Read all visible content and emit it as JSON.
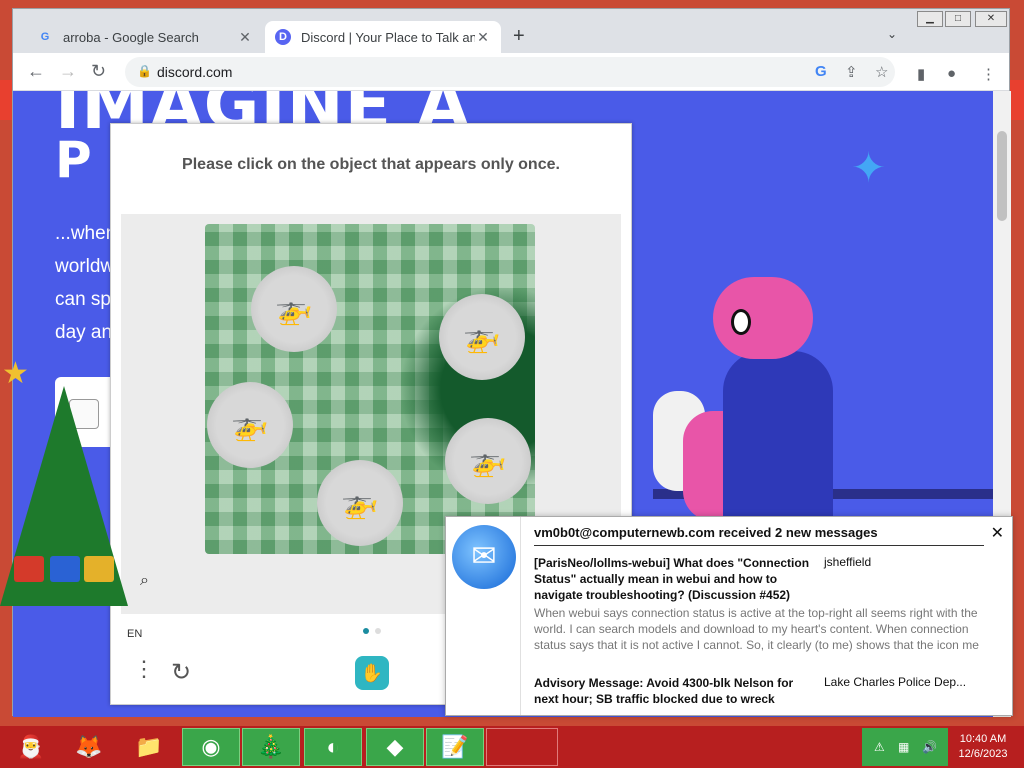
{
  "browser": {
    "tabs": [
      {
        "title": "arroba - Google Search",
        "favicon": "G"
      },
      {
        "title": "Discord | Your Place to Talk and H",
        "favicon": "D"
      }
    ],
    "url": "discord.com",
    "nav_icons": {
      "back": "←",
      "forward": "→",
      "reload": "↻"
    }
  },
  "page": {
    "hero_line1": "IMAGINE A",
    "hero_line2": "P",
    "desc_lines": [
      "...when",
      "worldw",
      "can sp",
      "day an"
    ]
  },
  "captcha": {
    "prompt": "Please click on the object that appears only once.",
    "language": "EN",
    "logo": "✋"
  },
  "notification": {
    "header": "vm0b0t@computernewb.com received 2 new messages",
    "messages": [
      {
        "subject": "[ParisNeo/lollms-webui] What does \"Connection Status\" actually mean in webui and how to navigate troubleshooting? (Discussion #452)",
        "from": "jsheffield",
        "preview": "When webui says connection status is active at the top-right all seems right with the world. I can search models and download to my heart's content. When connection status says that it is not active I cannot. So, it clearly (to me) shows that the icon me"
      },
      {
        "subject": "Advisory Message: Avoid 4300-blk Nelson for next hour; SB traffic blocked due to wreck",
        "from": "Lake Charles Police Dep..."
      }
    ]
  },
  "taskbar": {
    "time": "10:40 AM",
    "date": "12/6/2023"
  },
  "colors": {
    "discord_blurple": "#4a5be8",
    "taskbar_red": "#b71f1f",
    "taskbar_active_green": "#3aa64a"
  }
}
